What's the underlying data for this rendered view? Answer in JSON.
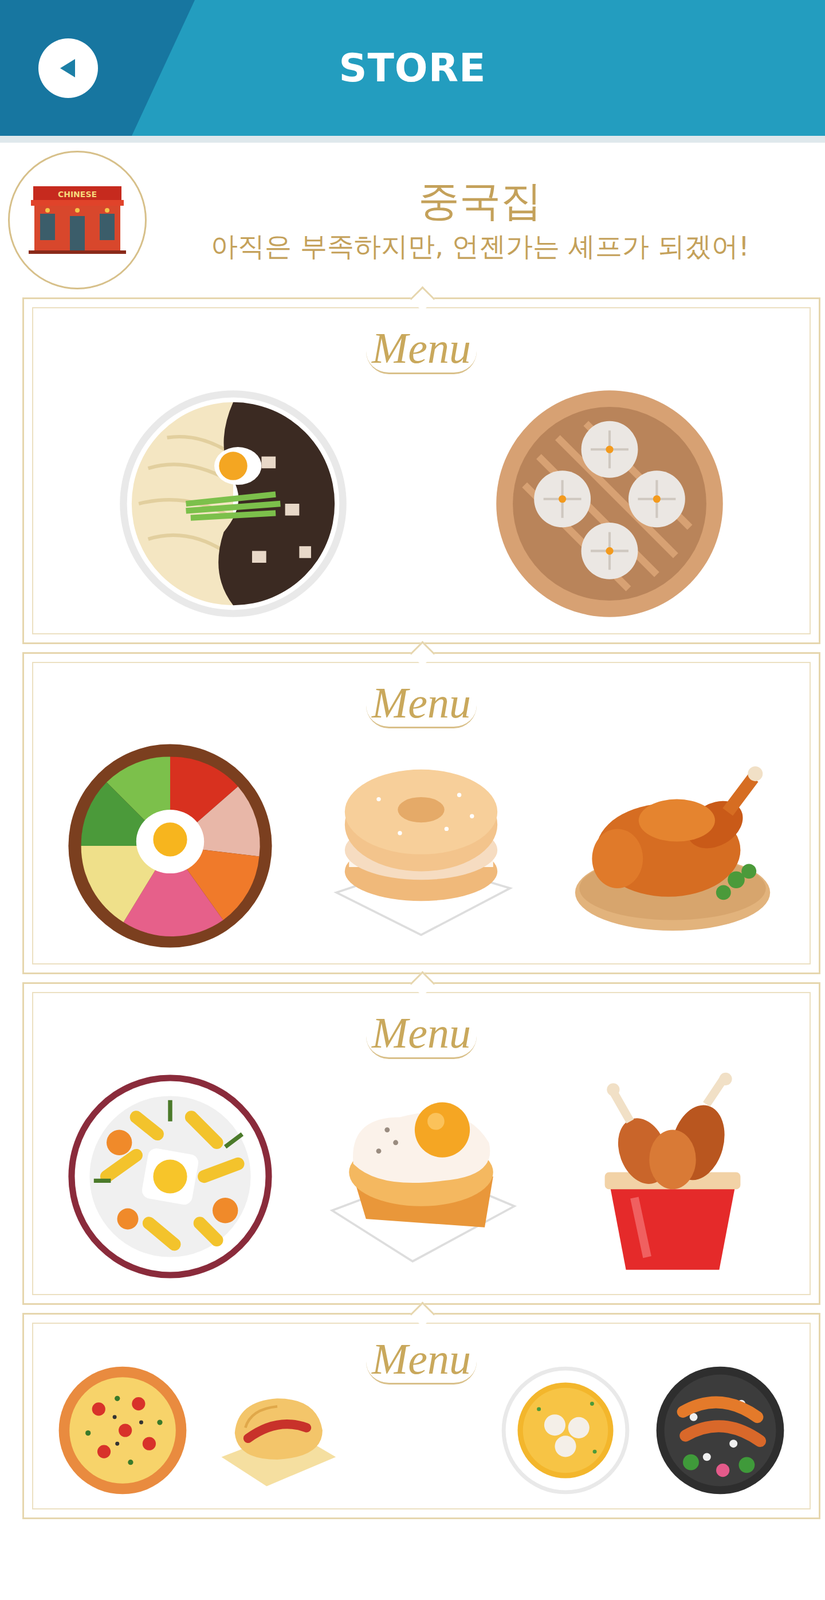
{
  "header": {
    "title": "STORE"
  },
  "shop": {
    "sign": "CHINESE",
    "name": "중국집",
    "subtitle": "아직은 부족하지만, 언젠가는 셰프가 되겠어!"
  },
  "menus": [
    {
      "title": "Menu",
      "items": [
        {
          "kind": "jajangmyeon"
        },
        {
          "kind": "dumplings"
        }
      ]
    },
    {
      "title": "Menu",
      "items": [
        {
          "kind": "bibimbap"
        },
        {
          "kind": "bagel"
        },
        {
          "kind": "roastchicken"
        }
      ]
    },
    {
      "title": "Menu",
      "items": [
        {
          "kind": "pasta"
        },
        {
          "kind": "eggtoast"
        },
        {
          "kind": "friedchicken"
        }
      ]
    },
    {
      "title": "Menu",
      "items": [
        {
          "kind": "pizza"
        },
        {
          "kind": "pastry"
        },
        {
          "kind": "soup"
        },
        {
          "kind": "shrimp"
        }
      ]
    }
  ]
}
